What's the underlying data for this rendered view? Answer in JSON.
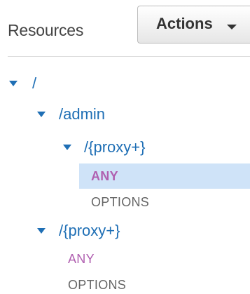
{
  "header": {
    "title": "Resources",
    "actions_label": "Actions"
  },
  "tree": {
    "root": {
      "path": "/"
    },
    "admin": {
      "path": "/admin"
    },
    "admin_proxy": {
      "path": "/{proxy+}",
      "methods": [
        "ANY",
        "OPTIONS"
      ]
    },
    "root_proxy": {
      "path": "/{proxy+}",
      "methods": [
        "ANY",
        "OPTIONS"
      ]
    }
  },
  "colors": {
    "resource_text": "#1f6fb5",
    "method_any": "#b05fb0",
    "method_options": "#666666",
    "selected_bg": "#cfe3f8"
  },
  "icons": [
    "caret-down-icon",
    "expand-toggle-icon"
  ]
}
